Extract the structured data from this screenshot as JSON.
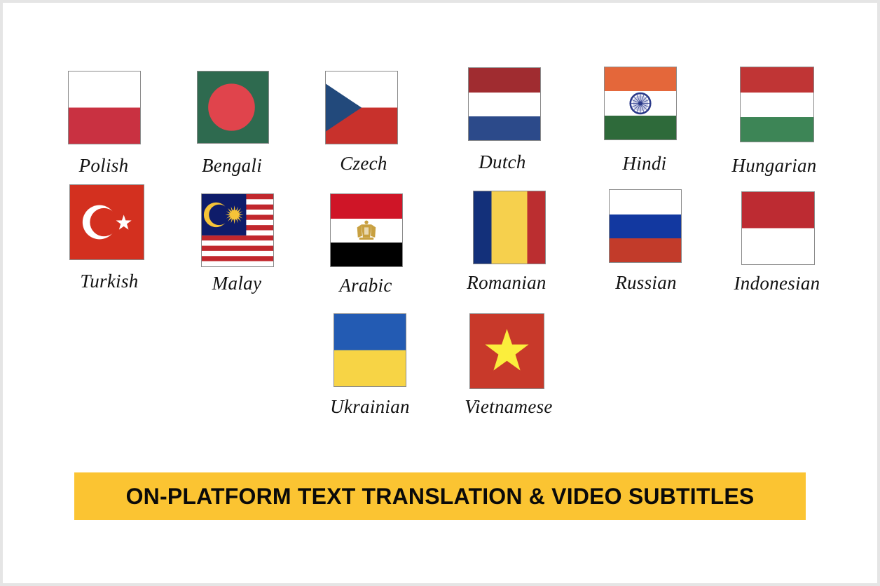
{
  "banner": {
    "text": "ON-PLATFORM TEXT TRANSLATION & VIDEO SUBTITLES",
    "color": "#fbc432"
  },
  "languages": [
    {
      "label": "Polish",
      "flag": "poland-flag",
      "colors": [
        "#ffffff",
        "#c93141"
      ]
    },
    {
      "label": "Bengali",
      "flag": "bangladesh-flag",
      "colors": [
        "#2e6a4f",
        "#e0444c"
      ]
    },
    {
      "label": "Czech",
      "flag": "czech-flag",
      "colors": [
        "#ffffff",
        "#c8312c",
        "#22497b"
      ]
    },
    {
      "label": "Dutch",
      "flag": "netherlands-flag",
      "colors": [
        "#a02c30",
        "#ffffff",
        "#2c4a8a"
      ]
    },
    {
      "label": "Hindi",
      "flag": "india-flag",
      "colors": [
        "#e4673a",
        "#ffffff",
        "#2e6a3a",
        "#2b3a8a"
      ]
    },
    {
      "label": "Hungarian",
      "flag": "hungary-flag",
      "colors": [
        "#c03535",
        "#ffffff",
        "#3d8556"
      ]
    },
    {
      "label": "Turkish",
      "flag": "turkey-flag",
      "colors": [
        "#d3301f",
        "#ffffff"
      ]
    },
    {
      "label": "Malay",
      "flag": "malaysia-flag",
      "colors": [
        "#c1272d",
        "#ffffff",
        "#0e1c6a",
        "#f5c338"
      ]
    },
    {
      "label": "Arabic",
      "flag": "egypt-flag",
      "colors": [
        "#cf1527",
        "#ffffff",
        "#000000",
        "#c8a040"
      ]
    },
    {
      "label": "Romanian",
      "flag": "romania-flag",
      "colors": [
        "#13307a",
        "#f6d04d",
        "#bb2e30"
      ]
    },
    {
      "label": "Russian",
      "flag": "russia-flag",
      "colors": [
        "#ffffff",
        "#1238a0",
        "#c23b2a"
      ]
    },
    {
      "label": "Indonesian",
      "flag": "indonesia-flag",
      "colors": [
        "#bd2b32",
        "#ffffff"
      ]
    },
    {
      "label": "Ukrainian",
      "flag": "ukraine-flag",
      "colors": [
        "#235bb3",
        "#f7d445"
      ]
    },
    {
      "label": "Vietnamese",
      "flag": "vietnam-flag",
      "colors": [
        "#c8392a",
        "#fbee3c"
      ]
    }
  ]
}
